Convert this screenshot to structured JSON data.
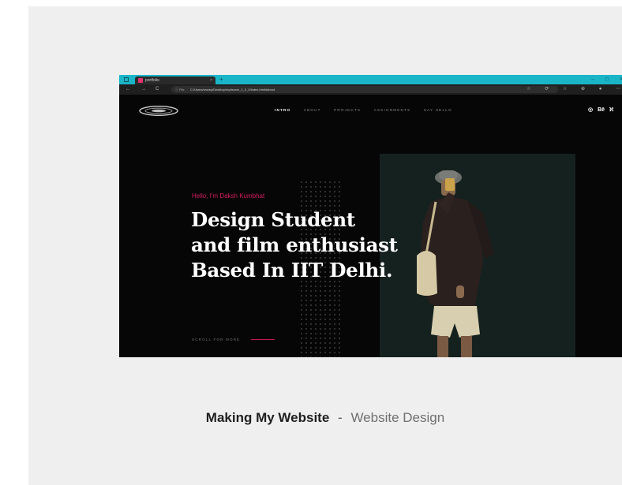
{
  "browser": {
    "tab_title": "portfolio",
    "tab_close": "×",
    "new_tab": "+",
    "window_controls": "– ◻ ✕",
    "nav_back": "←",
    "nav_forward": "→",
    "nav_reload": "C",
    "url_prefix": "ⓘ File",
    "url": "C:/Users/snowy/Desktop/mydsurce_1_0_0/index.html#about",
    "ext_icons": "☆ ⟳ ☆ ⊕ ● ⋯"
  },
  "site": {
    "menu": [
      "INTRO",
      "ABOUT",
      "PROJECTS",
      "ASSIGNMENTS",
      "SAY HELLO"
    ],
    "active_menu_index": 0,
    "social": [
      "◎",
      "Bē",
      "ℵ"
    ],
    "greeting": "Hello, I'm Daksh Kumbhat",
    "headline": [
      "Design Student",
      "and film enthusiast",
      "Based In IIT Delhi."
    ],
    "scroll_text": "SCROLL FOR MORE"
  },
  "caption": {
    "title": "Making My Website",
    "separator": "-",
    "subtitle": "Website Design"
  },
  "colors": {
    "accent": "#d81e62",
    "titlebar": "#1bb5c8",
    "card_bg": "#efefef",
    "site_bg": "#060606"
  }
}
